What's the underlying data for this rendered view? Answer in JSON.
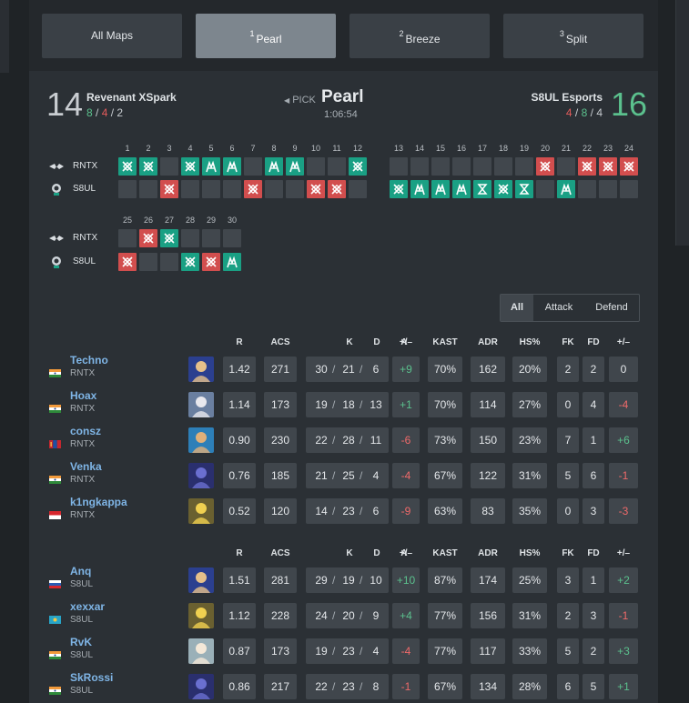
{
  "tabs": [
    {
      "num": "",
      "label": "All Maps"
    },
    {
      "num": "1",
      "label": "Pearl"
    },
    {
      "num": "2",
      "label": "Breeze"
    },
    {
      "num": "3",
      "label": "Split"
    }
  ],
  "match": {
    "map": "Pearl",
    "pick_label": "PICK",
    "duration": "1:06:54",
    "team1": {
      "name": "Revenant XSpark",
      "short": "RNTX",
      "score": "14",
      "atk": "8",
      "def": "4",
      "ot": "2"
    },
    "team2": {
      "name": "S8UL Esports",
      "short": "S8UL",
      "score": "16",
      "atk": "4",
      "def": "8",
      "ot": "4"
    }
  },
  "rounds": {
    "numbers": [
      "1",
      "2",
      "3",
      "4",
      "5",
      "6",
      "7",
      "8",
      "9",
      "10",
      "11",
      "12",
      "13",
      "14",
      "15",
      "16",
      "17",
      "18",
      "19",
      "20",
      "21",
      "22",
      "23",
      "24",
      "25",
      "26",
      "27",
      "28",
      "29",
      "30"
    ],
    "team1": [
      "W-def",
      "W-def",
      "",
      "W-def",
      "W-elim",
      "W-elim",
      "",
      "W-elim",
      "W-elim",
      "",
      "",
      "W-def",
      "",
      "",
      "",
      "",
      "",
      "",
      "",
      "L-def",
      "",
      "L-def",
      "L-def",
      "L-def",
      "",
      "L-def",
      "W-def",
      "",
      "",
      ""
    ],
    "team2": [
      "",
      "",
      "L-def",
      "",
      "",
      "",
      "L-def",
      "",
      "",
      "L-def",
      "L-def",
      "",
      "W-def",
      "W-elim",
      "W-elim",
      "W-elim",
      "W-time",
      "W-def",
      "W-time",
      "",
      "W-elim",
      "",
      "",
      "",
      "L-def",
      "",
      "",
      "W-def",
      "L-def",
      "W-elim"
    ]
  },
  "filters": [
    "All",
    "Attack",
    "Defend"
  ],
  "stat_headers": {
    "r": "R",
    "acs": "ACS",
    "k": "K",
    "d": "D",
    "a": "A",
    "pm": "+/–",
    "kast": "KAST",
    "adr": "ADR",
    "hs": "HS%",
    "fk": "FK",
    "fd": "FD",
    "fkpm": "+/–"
  },
  "team1_players": [
    {
      "name": "Techno",
      "team": "RNTX",
      "flag": "india",
      "agent": "neon",
      "r": "1.42",
      "acs": "271",
      "k": "30",
      "d": "21",
      "a": "6",
      "pm": "+9",
      "kast": "70%",
      "adr": "162",
      "hs": "20%",
      "fk": "2",
      "fd": "2",
      "fkpm": "0"
    },
    {
      "name": "Hoax",
      "team": "RNTX",
      "flag": "india",
      "agent": "jett",
      "r": "1.14",
      "acs": "173",
      "k": "19",
      "d": "18",
      "a": "13",
      "pm": "+1",
      "kast": "70%",
      "adr": "114",
      "hs": "27%",
      "fk": "0",
      "fd": "4",
      "fkpm": "-4"
    },
    {
      "name": "consz",
      "team": "RNTX",
      "flag": "mongolia",
      "agent": "harbor",
      "r": "0.90",
      "acs": "230",
      "k": "22",
      "d": "28",
      "a": "11",
      "pm": "-6",
      "kast": "73%",
      "adr": "150",
      "hs": "23%",
      "fk": "7",
      "fd": "1",
      "fkpm": "+6"
    },
    {
      "name": "Venka",
      "team": "RNTX",
      "flag": "india",
      "agent": "omen",
      "r": "0.76",
      "acs": "185",
      "k": "21",
      "d": "25",
      "a": "4",
      "pm": "-4",
      "kast": "67%",
      "adr": "122",
      "hs": "31%",
      "fk": "5",
      "fd": "6",
      "fkpm": "-1"
    },
    {
      "name": "k1ngkappa",
      "team": "RNTX",
      "flag": "indonesia",
      "agent": "killjoy",
      "r": "0.52",
      "acs": "120",
      "k": "14",
      "d": "23",
      "a": "6",
      "pm": "-9",
      "kast": "63%",
      "adr": "83",
      "hs": "35%",
      "fk": "0",
      "fd": "3",
      "fkpm": "-3"
    }
  ],
  "team2_players": [
    {
      "name": "Anq",
      "team": "S8UL",
      "flag": "russia",
      "agent": "neon",
      "r": "1.51",
      "acs": "281",
      "k": "29",
      "d": "19",
      "a": "10",
      "pm": "+10",
      "kast": "87%",
      "adr": "174",
      "hs": "25%",
      "fk": "3",
      "fd": "1",
      "fkpm": "+2"
    },
    {
      "name": "xexxar",
      "team": "S8UL",
      "flag": "kazakhstan",
      "agent": "killjoy",
      "r": "1.12",
      "acs": "228",
      "k": "24",
      "d": "20",
      "a": "9",
      "pm": "+4",
      "kast": "77%",
      "adr": "156",
      "hs": "31%",
      "fk": "2",
      "fd": "3",
      "fkpm": "-1"
    },
    {
      "name": "RvK",
      "team": "S8UL",
      "flag": "india",
      "agent": "sage",
      "r": "0.87",
      "acs": "173",
      "k": "19",
      "d": "23",
      "a": "4",
      "pm": "-4",
      "kast": "77%",
      "adr": "117",
      "hs": "33%",
      "fk": "5",
      "fd": "2",
      "fkpm": "+3"
    },
    {
      "name": "SkRossi",
      "team": "S8UL",
      "flag": "india",
      "agent": "omen",
      "r": "0.86",
      "acs": "217",
      "k": "22",
      "d": "23",
      "a": "8",
      "pm": "-1",
      "kast": "67%",
      "adr": "134",
      "hs": "28%",
      "fk": "6",
      "fd": "5",
      "fkpm": "+1"
    }
  ],
  "colors": {
    "win": "#1aa084",
    "loss": "#d24e4e",
    "positive": "#5bc08d",
    "negative": "#ef6a6a",
    "link": "#7fb5e6"
  }
}
